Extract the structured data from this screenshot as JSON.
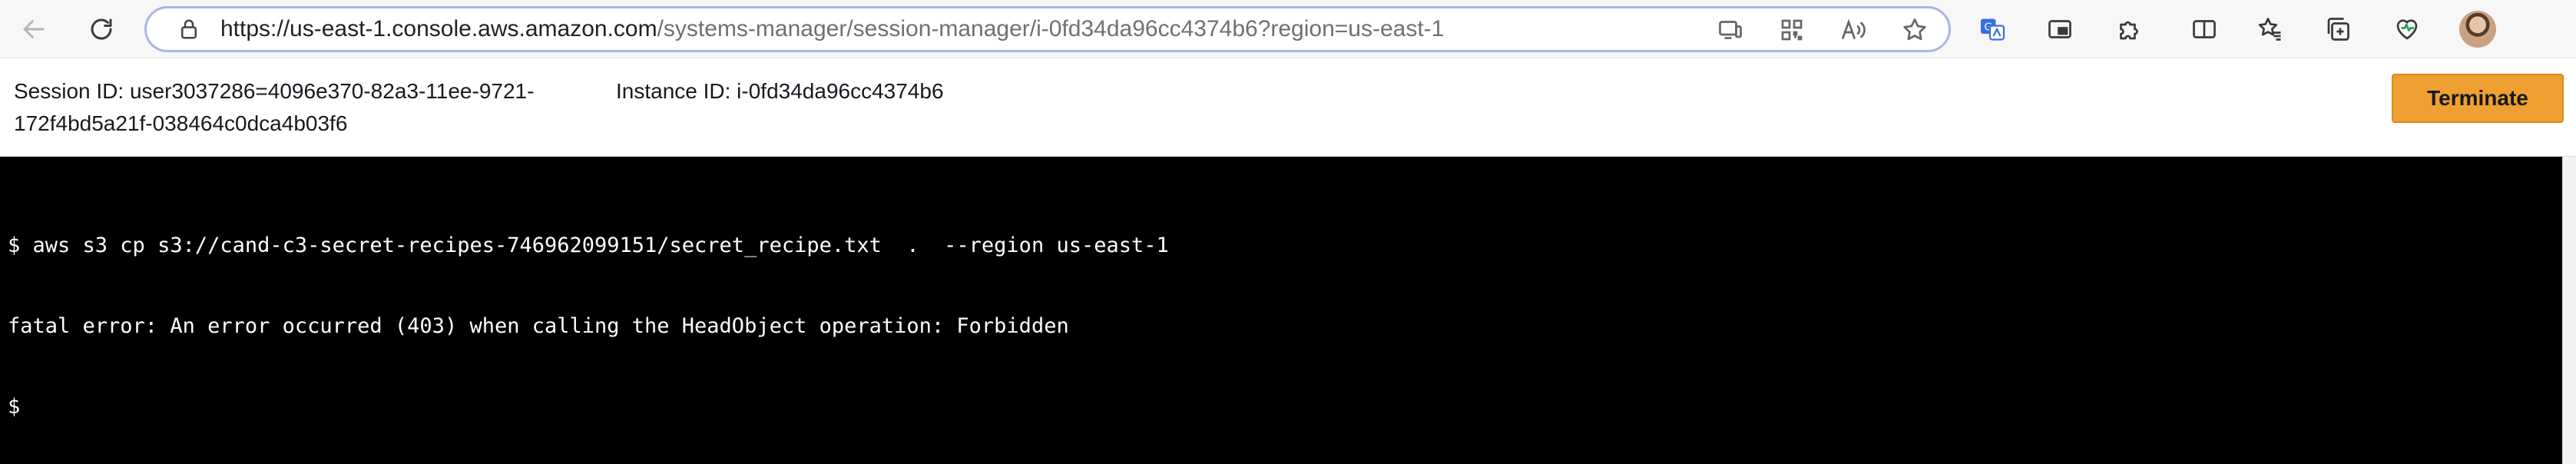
{
  "browser": {
    "url_host": "https://us-east-1.console.aws.amazon.com",
    "url_path": "/systems-manager/session-manager/i-0fd34da96cc4374b6?region=us-east-1"
  },
  "session": {
    "session_id_text": "Session ID: user3037286=4096e370-82a3-11ee-9721-172f4bd5a21f-038464c0dca4b03f6",
    "instance_id_text": "Instance ID: i-0fd34da96cc4374b6",
    "terminate_label": "Terminate"
  },
  "terminal": {
    "lines": [
      "$ aws s3 cp s3://cand-c3-secret-recipes-746962099151/secret_recipe.txt  .  --region us-east-1",
      "fatal error: An error occurred (403) when calling the HeadObject operation: Forbidden",
      "$"
    ]
  },
  "colors": {
    "terminate_button": "#f0a030",
    "terminal_bg": "#000000",
    "terminal_fg": "#ffffff",
    "urlbar_border": "#aab4e6"
  },
  "icons": {
    "back": "arrow-left-icon",
    "reload": "reload-icon",
    "lock": "lock-icon",
    "app_available": "app-available-icon",
    "qr_code": "qr-code-icon",
    "read_aloud": "read-aloud-icon",
    "favorite": "star-icon",
    "translate": "translate-icon",
    "picture_in_picture": "picture-in-picture-icon",
    "extensions": "puzzle-icon",
    "split_screen": "split-screen-icon",
    "favorites": "favorites-icon",
    "collections": "collections-icon",
    "browser_essentials": "heart-pulse-icon",
    "profile": "avatar"
  }
}
